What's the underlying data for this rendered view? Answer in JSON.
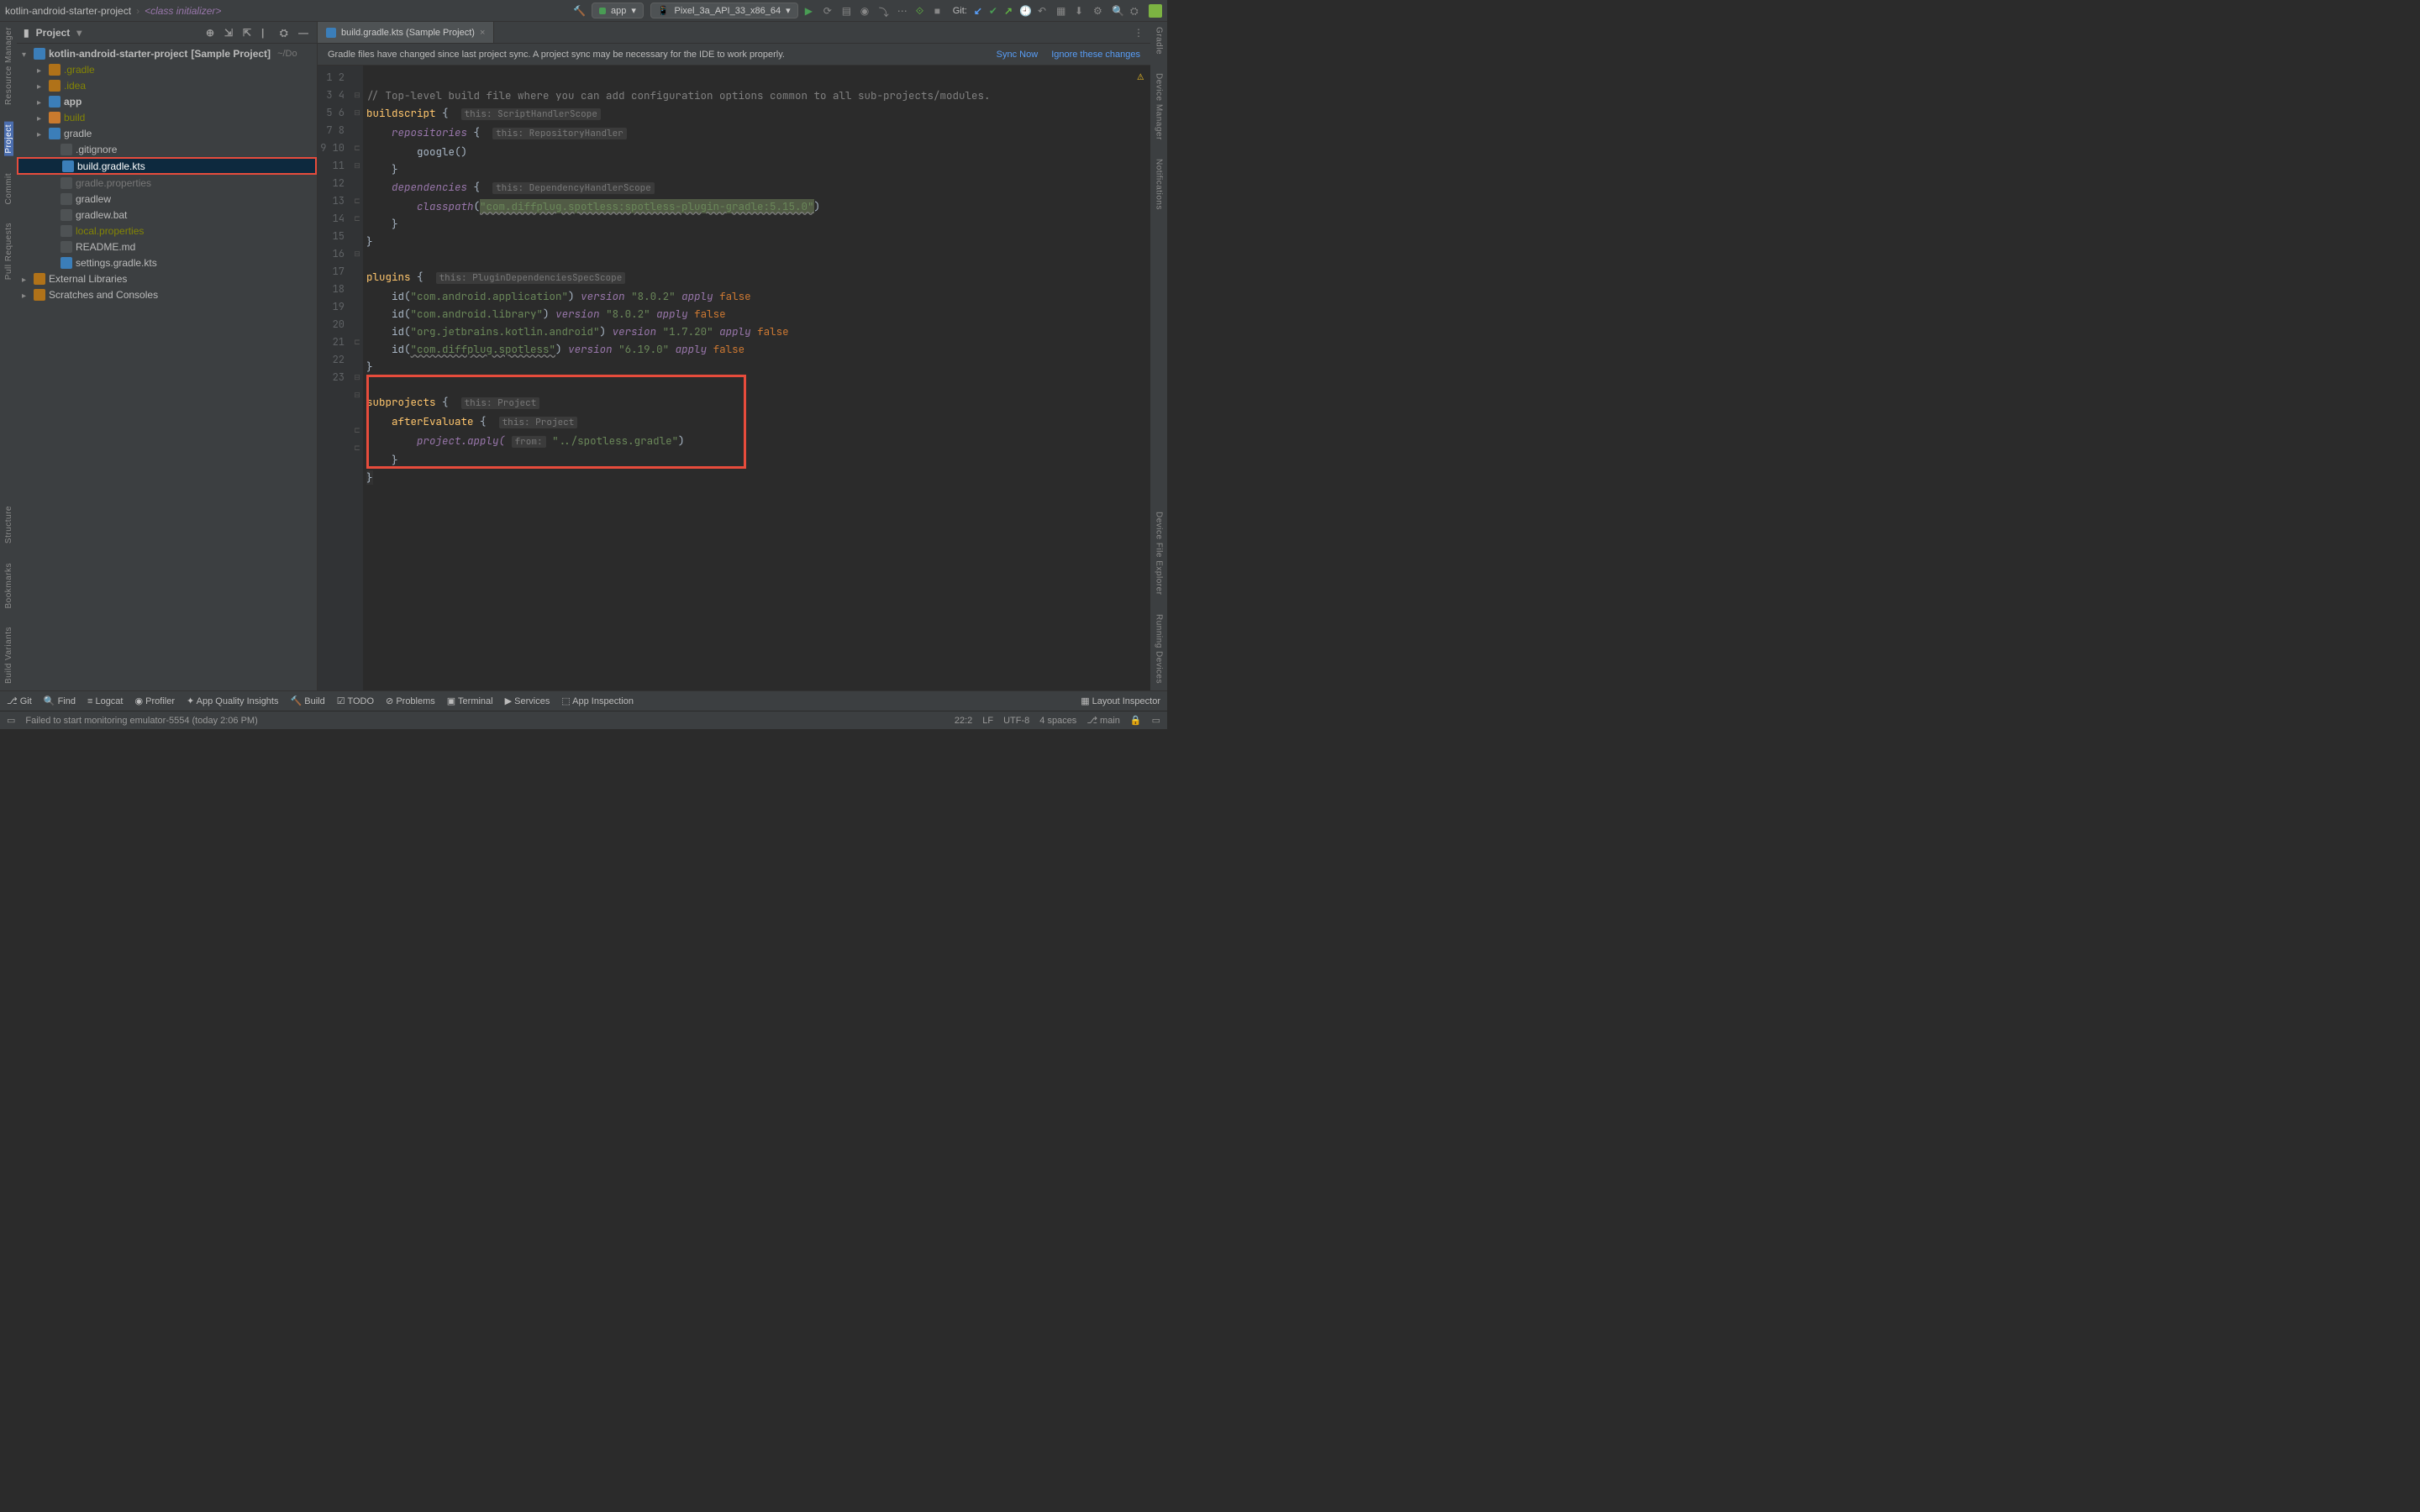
{
  "breadcrumb": {
    "project": "kotlin-android-starter-project",
    "context": "<class initializer>"
  },
  "run": {
    "config": "app",
    "device": "Pixel_3a_API_33_x86_64",
    "git_label": "Git:"
  },
  "left_tools": [
    "Resource Manager",
    "Project",
    "Commit",
    "Pull Requests",
    "Structure",
    "Bookmarks",
    "Build Variants"
  ],
  "right_tools": [
    "Gradle",
    "Device Manager",
    "Notifications",
    "Device File Explorer",
    "Running Devices"
  ],
  "panel": {
    "title": "Project",
    "root": "kotlin-android-starter-project",
    "root_suffix": "[Sample Project]",
    "root_path": "~/Do",
    "items": [
      {
        "name": ".gradle",
        "cls": "muted"
      },
      {
        "name": ".idea",
        "cls": "muted"
      },
      {
        "name": "app",
        "cls": "bold",
        "folder": "blue"
      },
      {
        "name": "build",
        "cls": "muted",
        "folder": "orange"
      },
      {
        "name": "gradle",
        "cls": ""
      },
      {
        "name": ".gitignore",
        "cls": "",
        "leaf": true
      },
      {
        "name": "build.gradle.kts",
        "cls": "",
        "leaf": true,
        "selected": true
      },
      {
        "name": "gradle.properties",
        "cls": "dim",
        "leaf": true
      },
      {
        "name": "gradlew",
        "cls": "",
        "leaf": true
      },
      {
        "name": "gradlew.bat",
        "cls": "",
        "leaf": true
      },
      {
        "name": "local.properties",
        "cls": "muted",
        "leaf": true
      },
      {
        "name": "README.md",
        "cls": "",
        "leaf": true
      },
      {
        "name": "settings.gradle.kts",
        "cls": "",
        "leaf": true
      }
    ],
    "ext_lib": "External Libraries",
    "scratches": "Scratches and Consoles"
  },
  "tab": {
    "label": "build.gradle.kts (Sample Project)"
  },
  "banner": {
    "msg": "Gradle files have changed since last project sync. A project sync may be necessary for the IDE to work properly.",
    "sync": "Sync Now",
    "ignore": "Ignore these changes"
  },
  "code": {
    "l1": "// Top-level build file where you can add configuration options common to all sub-projects/modules.",
    "l2a": "buildscript",
    "l2b": "{",
    "h2": "this: ScriptHandlerScope",
    "l3a": "repositories",
    "l3b": "{",
    "h3": "this: RepositoryHandler",
    "l4": "google()",
    "l5": "}",
    "l6a": "dependencies",
    "l6b": "{",
    "h6": "this: DependencyHandlerScope",
    "l7a": "classpath",
    "l7s": "\"com.diffplug.spotless:spotless-plugin-gradle:5.15.0\"",
    "l8": "}",
    "l9": "}",
    "l11a": "plugins",
    "l11b": "{",
    "h11": "this: PluginDependenciesSpecScope",
    "l12id": "id",
    "l12s": "\"com.android.application\"",
    "l12v": "version",
    "l12vs": "\"8.0.2\"",
    "l12ap": "apply",
    "l12f": "false",
    "l13s": "\"com.android.library\"",
    "l13vs": "\"8.0.2\"",
    "l14s": "\"org.jetbrains.kotlin.android\"",
    "l14vs": "\"1.7.20\"",
    "l15s": "\"com.diffplug.spotless\"",
    "l15vs": "\"6.19.0\"",
    "l16": "}",
    "l18a": "subprojects",
    "l18b": "{",
    "h18": "this: Project",
    "l19a": "afterEvaluate",
    "l19b": "{",
    "h19": "this: Project",
    "l20a": "project",
    "l20b": ".apply(",
    "h20": "from:",
    "l20s": "\"../spotless.gradle\"",
    "l21": "}",
    "l22": "}"
  },
  "bottom": {
    "git": "Git",
    "find": "Find",
    "logcat": "Logcat",
    "profiler": "Profiler",
    "quality": "App Quality Insights",
    "build": "Build",
    "todo": "TODO",
    "problems": "Problems",
    "terminal": "Terminal",
    "services": "Services",
    "inspection": "App Inspection",
    "layout": "Layout Inspector"
  },
  "status": {
    "msg": "Failed to start monitoring emulator-5554 (today 2:06 PM)",
    "pos": "22:2",
    "lf": "LF",
    "enc": "UTF-8",
    "indent": "4 spaces",
    "branch": "main"
  }
}
